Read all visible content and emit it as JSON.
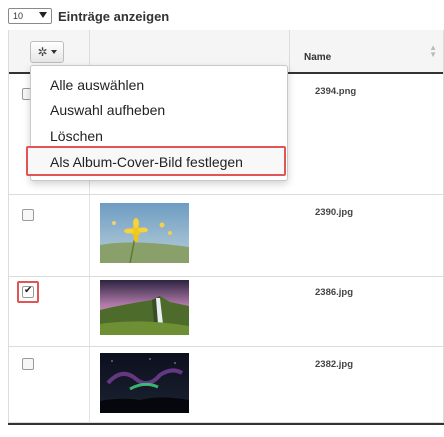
{
  "length_control": {
    "selected_value": "10",
    "label": "Einträge anzeigen"
  },
  "table": {
    "bulk_actions_icon": "gear-icon",
    "columns": {
      "name": "Name"
    },
    "rows": [
      {
        "filename": "2394.png",
        "checked": false
      },
      {
        "filename": "2390.jpg",
        "checked": false
      },
      {
        "filename": "2386.jpg",
        "checked": true
      },
      {
        "filename": "2382.jpg",
        "checked": false
      }
    ]
  },
  "bulk_menu": {
    "items": [
      {
        "label": "Alle auswählen"
      },
      {
        "label": "Auswahl aufheben"
      },
      {
        "label": "Löschen"
      },
      {
        "label": "Als Album-Cover-Bild festlegen",
        "highlighted": true
      }
    ]
  },
  "colors": {
    "highlight_border": "#e05555",
    "header_border": "#333333"
  }
}
